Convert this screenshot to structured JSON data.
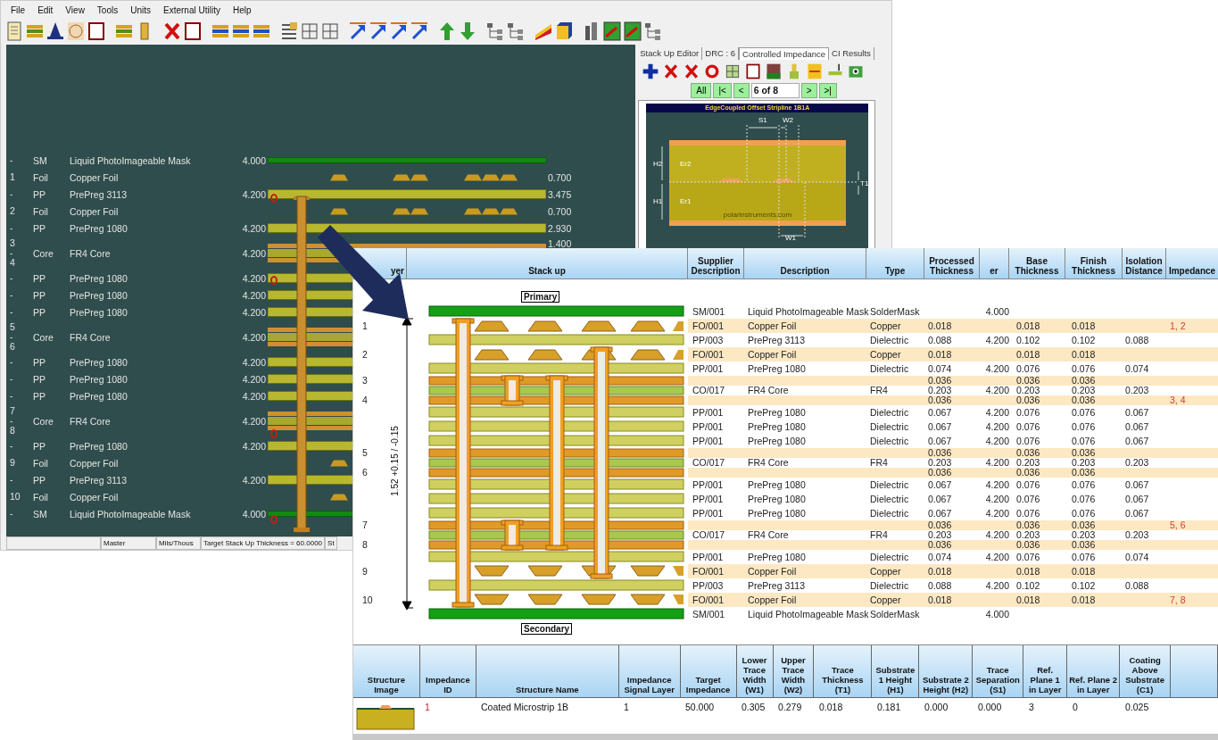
{
  "menu": [
    "File",
    "Edit",
    "View",
    "Tools",
    "Units",
    "External Utility",
    "Help"
  ],
  "layers": [
    {
      "kind": "mask",
      "num": [
        "-"
      ],
      "type": "SM",
      "name": "Liquid PhotoImageable Mask",
      "er": "4.000"
    },
    {
      "kind": "foil",
      "num": [
        "1"
      ],
      "type": "Foil",
      "name": "Copper Foil",
      "thickness": "0.700"
    },
    {
      "kind": "prepreg",
      "num": [
        "-"
      ],
      "type": "PP",
      "name": "PrePreg 3113",
      "er": "4.200",
      "thickness": "3.475"
    },
    {
      "kind": "foil",
      "num": [
        "2"
      ],
      "type": "Foil",
      "name": "Copper Foil",
      "thickness": "0.700"
    },
    {
      "kind": "prepreg",
      "num": [
        "-"
      ],
      "type": "PP",
      "name": "PrePreg 1080",
      "er": "4.200",
      "thickness": "2.930"
    },
    {
      "kind": "core",
      "num": [
        "3",
        "-",
        "4"
      ],
      "type": "Core",
      "name": "FR4 Core",
      "er": "4.200",
      "thickness": "1.400"
    },
    {
      "kind": "prepreg",
      "num": [
        "-"
      ],
      "type": "PP",
      "name": "PrePreg 1080",
      "er": "4.200"
    },
    {
      "kind": "prepreg",
      "num": [
        "-"
      ],
      "type": "PP",
      "name": "PrePreg 1080",
      "er": "4.200"
    },
    {
      "kind": "prepreg",
      "num": [
        "-"
      ],
      "type": "PP",
      "name": "PrePreg 1080",
      "er": "4.200"
    },
    {
      "kind": "core",
      "num": [
        "5",
        "-",
        "6"
      ],
      "type": "Core",
      "name": "FR4 Core",
      "er": "4.200"
    },
    {
      "kind": "prepreg",
      "num": [
        "-"
      ],
      "type": "PP",
      "name": "PrePreg 1080",
      "er": "4.200"
    },
    {
      "kind": "prepreg",
      "num": [
        "-"
      ],
      "type": "PP",
      "name": "PrePreg 1080",
      "er": "4.200"
    },
    {
      "kind": "prepreg",
      "num": [
        "-"
      ],
      "type": "PP",
      "name": "PrePreg 1080",
      "er": "4.200"
    },
    {
      "kind": "core",
      "num": [
        "7",
        "-",
        "8"
      ],
      "type": "Core",
      "name": "FR4 Core",
      "er": "4.200"
    },
    {
      "kind": "prepreg",
      "num": [
        "-"
      ],
      "type": "PP",
      "name": "PrePreg 1080",
      "er": "4.200"
    },
    {
      "kind": "foil",
      "num": [
        "9"
      ],
      "type": "Foil",
      "name": "Copper Foil"
    },
    {
      "kind": "prepreg",
      "num": [
        "-"
      ],
      "type": "PP",
      "name": "PrePreg 3113",
      "er": "4.200"
    },
    {
      "kind": "foil",
      "num": [
        "10"
      ],
      "type": "Foil",
      "name": "Copper Foil"
    },
    {
      "kind": "mask",
      "num": [
        "-"
      ],
      "type": "SM",
      "name": "Liquid PhotoImageable Mask",
      "er": "4.000"
    }
  ],
  "status_bar": [
    "Master",
    "Mils/Thous",
    "Target Stack Up Thickness = 60.0000",
    "St"
  ],
  "panel": {
    "tabs": [
      {
        "label": "Stack Up Editor",
        "selected": false
      },
      {
        "label": "DRC : 6",
        "selected": false
      },
      {
        "label": "Controlled Impedance",
        "selected": true
      },
      {
        "label": "CI Results",
        "selected": false
      }
    ],
    "nav_before": [
      "All",
      "|<",
      "<"
    ],
    "position": "6 of 8",
    "nav_after": [
      ">",
      ">|"
    ],
    "diagram": {
      "title": "EdgeCoupled Offset Stripline 1B1A",
      "s1": "S1",
      "w2": "W2",
      "h2": "H2",
      "er2": "Er2",
      "h1": "H1",
      "er1": "Er1",
      "t1": "T1",
      "w1": "W1",
      "site": "polarinstruments.com"
    }
  },
  "stackup": {
    "columns": [
      "yer",
      "Stack up",
      "Supplier Description",
      "Description",
      "Type",
      "Processed Thickness",
      "er",
      "Base Thickness",
      "Finish Thickness",
      "Isolation Distance",
      "Impedance"
    ],
    "top_label": "Primary",
    "bottom_label": "Secondary",
    "thickness_label": "1.52 +0.15 / -0.15",
    "lines": [
      {
        "kind": "mask",
        "supplier": "SM/001",
        "description": "Liquid PhotoImageable Mask",
        "type": "SolderMask",
        "er": "4.000"
      },
      {
        "kind": "foil",
        "layer": "1",
        "supplier": "FO/001",
        "description": "Copper Foil",
        "type": "Copper",
        "processed": "0.018",
        "base": "0.018",
        "finish": "0.018",
        "impedance": "1, 2"
      },
      {
        "kind": "prepreg",
        "supplier": "PP/003",
        "description": "PrePreg 3113",
        "type": "Dielectric",
        "processed": "0.088",
        "er": "4.200",
        "base": "0.102",
        "finish": "0.102",
        "isolation": "0.088"
      },
      {
        "kind": "foil",
        "layer": "2",
        "supplier": "FO/001",
        "description": "Copper Foil",
        "type": "Copper",
        "processed": "0.018",
        "base": "0.018",
        "finish": "0.018"
      },
      {
        "kind": "prepreg",
        "supplier": "PP/001",
        "description": "PrePreg 1080",
        "type": "Dielectric",
        "processed": "0.074",
        "er": "4.200",
        "base": "0.076",
        "finish": "0.076",
        "isolation": "0.074"
      },
      {
        "kind": "core_copper",
        "layer": "3",
        "processed": "0.036",
        "base": "0.036",
        "finish": "0.036"
      },
      {
        "kind": "core",
        "supplier": "CO/017",
        "description": "FR4 Core",
        "type": "FR4",
        "processed": "0.203",
        "er": "4.200",
        "base": "0.203",
        "finish": "0.203",
        "isolation": "0.203"
      },
      {
        "kind": "core_copper",
        "layer": "4",
        "processed": "0.036",
        "base": "0.036",
        "finish": "0.036",
        "impedance": "3, 4"
      },
      {
        "kind": "prepreg",
        "supplier": "PP/001",
        "description": "PrePreg 1080",
        "type": "Dielectric",
        "processed": "0.067",
        "er": "4.200",
        "base": "0.076",
        "finish": "0.076",
        "isolation": "0.067"
      },
      {
        "kind": "prepreg",
        "supplier": "PP/001",
        "description": "PrePreg 1080",
        "type": "Dielectric",
        "processed": "0.067",
        "er": "4.200",
        "base": "0.076",
        "finish": "0.076",
        "isolation": "0.067"
      },
      {
        "kind": "prepreg",
        "supplier": "PP/001",
        "description": "PrePreg 1080",
        "type": "Dielectric",
        "processed": "0.067",
        "er": "4.200",
        "base": "0.076",
        "finish": "0.076",
        "isolation": "0.067"
      },
      {
        "kind": "core_copper",
        "layer": "5",
        "processed": "0.036",
        "base": "0.036",
        "finish": "0.036"
      },
      {
        "kind": "core",
        "supplier": "CO/017",
        "description": "FR4 Core",
        "type": "FR4",
        "processed": "0.203",
        "er": "4.200",
        "base": "0.203",
        "finish": "0.203",
        "isolation": "0.203"
      },
      {
        "kind": "core_copper",
        "layer": "6",
        "processed": "0.036",
        "base": "0.036",
        "finish": "0.036"
      },
      {
        "kind": "prepreg",
        "supplier": "PP/001",
        "description": "PrePreg 1080",
        "type": "Dielectric",
        "processed": "0.067",
        "er": "4.200",
        "base": "0.076",
        "finish": "0.076",
        "isolation": "0.067"
      },
      {
        "kind": "prepreg",
        "supplier": "PP/001",
        "description": "PrePreg 1080",
        "type": "Dielectric",
        "processed": "0.067",
        "er": "4.200",
        "base": "0.076",
        "finish": "0.076",
        "isolation": "0.067"
      },
      {
        "kind": "prepreg",
        "supplier": "PP/001",
        "description": "PrePreg 1080",
        "type": "Dielectric",
        "processed": "0.067",
        "er": "4.200",
        "base": "0.076",
        "finish": "0.076",
        "isolation": "0.067"
      },
      {
        "kind": "core_copper",
        "layer": "7",
        "processed": "0.036",
        "base": "0.036",
        "finish": "0.036",
        "impedance": "5, 6"
      },
      {
        "kind": "core",
        "supplier": "CO/017",
        "description": "FR4 Core",
        "type": "FR4",
        "processed": "0.203",
        "er": "4.200",
        "base": "0.203",
        "finish": "0.203",
        "isolation": "0.203"
      },
      {
        "kind": "core_copper",
        "layer": "8",
        "processed": "0.036",
        "base": "0.036",
        "finish": "0.036"
      },
      {
        "kind": "prepreg",
        "supplier": "PP/001",
        "description": "PrePreg 1080",
        "type": "Dielectric",
        "processed": "0.074",
        "er": "4.200",
        "base": "0.076",
        "finish": "0.076",
        "isolation": "0.074"
      },
      {
        "kind": "foil",
        "layer": "9",
        "supplier": "FO/001",
        "description": "Copper Foil",
        "type": "Copper",
        "processed": "0.018",
        "base": "0.018",
        "finish": "0.018"
      },
      {
        "kind": "prepreg",
        "supplier": "PP/003",
        "description": "PrePreg 3113",
        "type": "Dielectric",
        "processed": "0.088",
        "er": "4.200",
        "base": "0.102",
        "finish": "0.102",
        "isolation": "0.088"
      },
      {
        "kind": "foil",
        "layer": "10",
        "supplier": "FO/001",
        "description": "Copper Foil",
        "type": "Copper",
        "processed": "0.018",
        "base": "0.018",
        "finish": "0.018",
        "impedance": "7, 8"
      },
      {
        "kind": "mask",
        "supplier": "SM/001",
        "description": "Liquid PhotoImageable Mask",
        "type": "SolderMask",
        "er": "4.000"
      }
    ]
  },
  "impedance_table": {
    "image_column": "Structure Image",
    "columns": [
      "Impedance ID",
      "Structure Name",
      "Impedance Signal Layer",
      "Target Impedance",
      "Lower Trace Width (W1)",
      "Upper Trace Width (W2)",
      "Trace Thickness (T1)",
      "Substrate 1 Height (H1)",
      "Substrate 2 Height (H2)",
      "Trace Separation (S1)",
      "Ref. Plane 1 in Layer",
      "Ref. Plane 2 in Layer",
      "Coating Above Substrate (C1)"
    ],
    "rows": [
      {
        "cells": [
          "1",
          "Coated Microstrip 1B",
          "1",
          "50.000",
          "0.305",
          "0.279",
          "0.018",
          "0.181",
          "0.000",
          "0.000",
          "3",
          "0",
          "0.025"
        ]
      }
    ]
  }
}
